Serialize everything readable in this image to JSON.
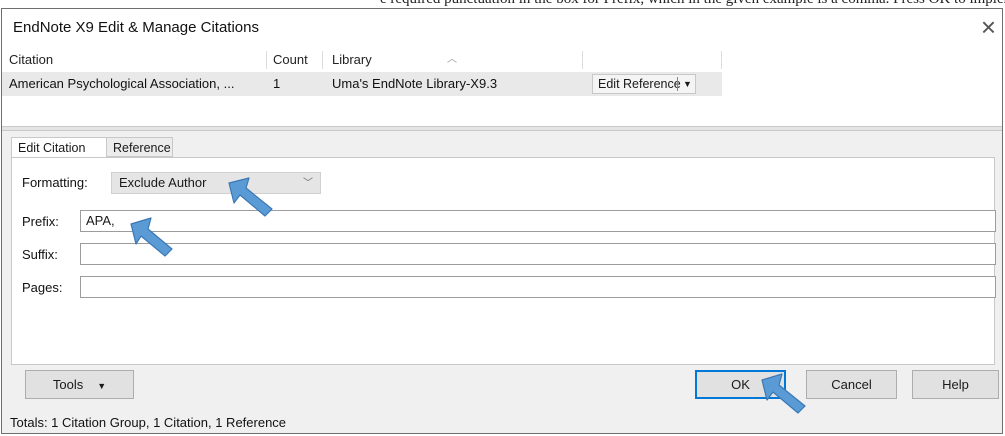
{
  "window": {
    "title": "EndNote X9 Edit & Manage Citations",
    "close_glyph": "×"
  },
  "table": {
    "headers": [
      "Citation",
      "Count",
      "Library"
    ],
    "rows": [
      {
        "citation": "American Psychological Association, ...",
        "count": "1",
        "library": "Uma's EndNote Library-X9.3",
        "action": "Edit Reference"
      }
    ]
  },
  "tabs": {
    "edit_citation": "Edit Citation",
    "reference": "Reference"
  },
  "form": {
    "formatting_label": "Formatting:",
    "formatting_value": "Exclude Author",
    "prefix_label": "Prefix:",
    "prefix_value": "APA,",
    "suffix_label": "Suffix:",
    "suffix_value": "",
    "pages_label": "Pages:",
    "pages_value": ""
  },
  "buttons": {
    "tools": "Tools",
    "ok": "OK",
    "cancel": "Cancel",
    "help": "Help"
  },
  "status": "Totals: 1 Citation Group, 1 Citation, 1 Reference",
  "icons": {
    "close": "close-icon",
    "sort": "sort-caret-icon",
    "dropdown": "chevron-down-icon",
    "annotation": "arrow-pointer-icon"
  },
  "colors": {
    "ok_border": "#0078d7",
    "annotation_arrow": "#5b9bd5",
    "row_highlight": "#e9e9e9"
  }
}
